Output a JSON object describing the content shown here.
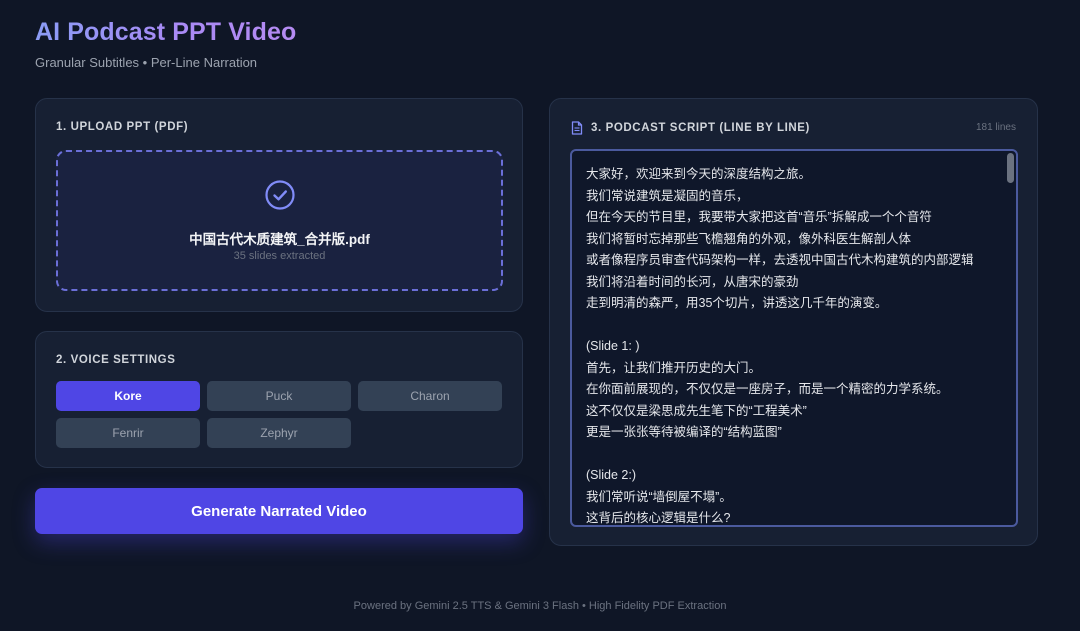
{
  "header": {
    "title": "AI Podcast PPT Video",
    "subtitle": "Granular Subtitles • Per-Line Narration"
  },
  "upload": {
    "heading": "1. UPLOAD PPT (PDF)",
    "file_name": "中国古代木质建筑_合并版.pdf",
    "file_meta": "35 slides extracted",
    "icon": "check-circle-icon"
  },
  "voice": {
    "heading": "2. VOICE SETTINGS",
    "selected": "Kore",
    "options": [
      "Kore",
      "Puck",
      "Charon",
      "Fenrir",
      "Zephyr"
    ]
  },
  "generate": {
    "label": "Generate Narrated Video"
  },
  "script": {
    "heading": "3. PODCAST SCRIPT (LINE BY LINE)",
    "line_count": "181 lines",
    "icon": "document-icon",
    "lines": [
      "大家好，欢迎来到今天的深度结构之旅。",
      "我们常说建筑是凝固的音乐，",
      "但在今天的节目里，我要带大家把这首“音乐”拆解成一个个音符",
      "我们将暂时忘掉那些飞檐翘角的外观，像外科医生解剖人体",
      "或者像程序员审查代码架构一样，去透视中国古代木构建筑的内部逻辑",
      "我们将沿着时间的长河，从唐宋的豪劲",
      "走到明清的森严，用35个切片，讲透这几千年的演变。",
      "",
      "(Slide 1: )",
      "首先，让我们推开历史的大门。",
      "在你面前展现的，不仅仅是一座房子，而是一个精密的力学系统。",
      "这不仅仅是梁思成先生笔下的“工程美术”",
      "更是一张张等待被编译的“结构蓝图”",
      "",
      "(Slide 2:)",
      "我们常听说“墙倒屋不塌”。",
      "这背后的核心逻辑是什么?"
    ]
  },
  "footer": {
    "text": "Powered by Gemini 2.5 TTS & Gemini 3 Flash • High Fidelity PDF Extraction"
  },
  "colors": {
    "background": "#0f1626",
    "card": "#172033",
    "accent": "#4f46e5",
    "title_gradient_start": "#8b9cf5",
    "title_gradient_end": "#b58bf2"
  }
}
